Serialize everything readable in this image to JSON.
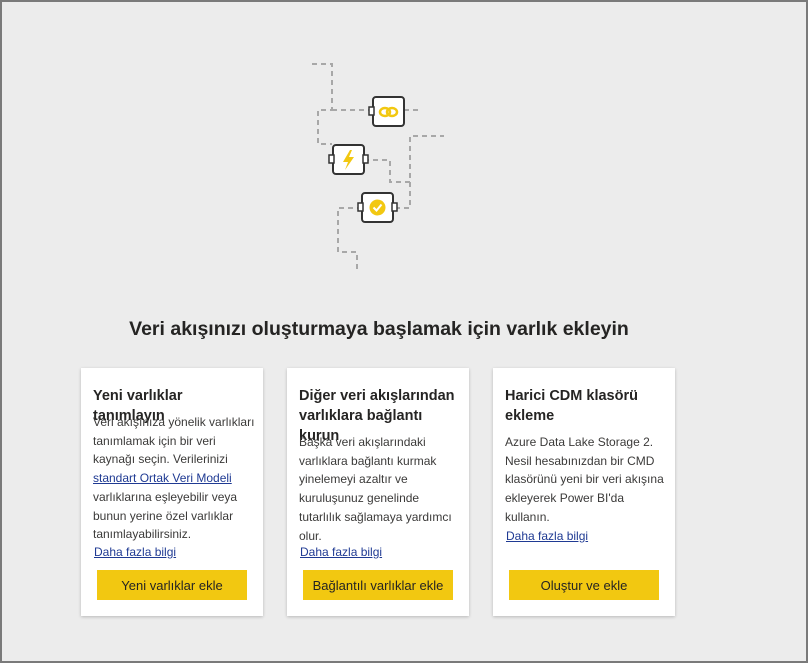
{
  "headline": "Veri akışınızı oluşturmaya başlamak için varlık ekleyin",
  "illustration": {
    "icons": [
      "link-icon",
      "lightning-icon",
      "certified-badge-icon"
    ],
    "accent": "#f2c811"
  },
  "cards": [
    {
      "title": "Yeni varlıklar tanımlayın",
      "body_before": "Veri akışınıza yönelik varlıkları tanımlamak için bir veri kaynağı seçin. Verilerinizi ",
      "body_link": "standart Ortak Veri Modeli",
      "body_after": " varlıklarına eşleyebilir veya bunun yerine özel varlıklar tanımlayabilirsiniz.",
      "learn_more": "Daha fazla bilgi",
      "button": "Yeni varlıklar ekle"
    },
    {
      "title": "Diğer veri akışlarından varlıklara bağlantı kurun",
      "body": "Başka veri akışlarındaki varlıklara bağlantı kurmak yinelemeyi azaltır ve kuruluşunuz genelinde tutarlılık sağlamaya yardımcı olur.",
      "learn_more": "Daha fazla bilgi",
      "button": "Bağlantılı varlıklar ekle"
    },
    {
      "title": "Harici CDM klasörü ekleme",
      "body": "Azure Data Lake Storage 2. Nesil hesabınızdan bir CMD klasörünü yeni bir veri akışına ekleyerek Power BI'da kullanın.",
      "learn_more": "Daha fazla bilgi",
      "button": "Oluştur ve ekle"
    }
  ],
  "colors": {
    "background": "#ececec",
    "button": "#f2c811",
    "link": "#1f3a93",
    "text": "#252423"
  }
}
